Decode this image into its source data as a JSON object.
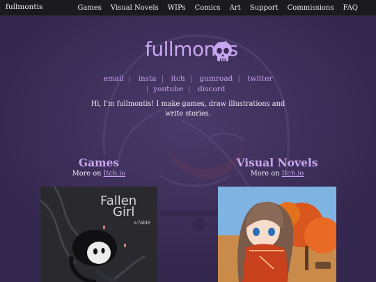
{
  "topbar": {
    "brand": "fullmontis",
    "nav": [
      "Games",
      "Visual Novels",
      "WIPs",
      "Comics",
      "Art",
      "Support",
      "Commissions",
      "FAQ"
    ]
  },
  "logo": {
    "text": "fullmontis",
    "icon": "skull-icon"
  },
  "links": [
    "email",
    "insta",
    "itch",
    "gumroad",
    "twitter",
    "youtube",
    "discord"
  ],
  "intro": "Hi, I'm fullmontis! I make games, draw illustrations and write stories.",
  "sections": [
    {
      "title": "Games",
      "more_prefix": "More on ",
      "more_link": "Itch.io",
      "thumb_title_1": "Fallen",
      "thumb_title_2": "Girl",
      "thumb_sub": "a fable"
    },
    {
      "title": "Visual Novels",
      "more_prefix": "More on ",
      "more_link": "Itch.io"
    }
  ],
  "colors": {
    "background": "#3a2b55",
    "accent": "#c9a7f0",
    "link": "#c6a4f2",
    "topbar": "#1a1a1f"
  }
}
